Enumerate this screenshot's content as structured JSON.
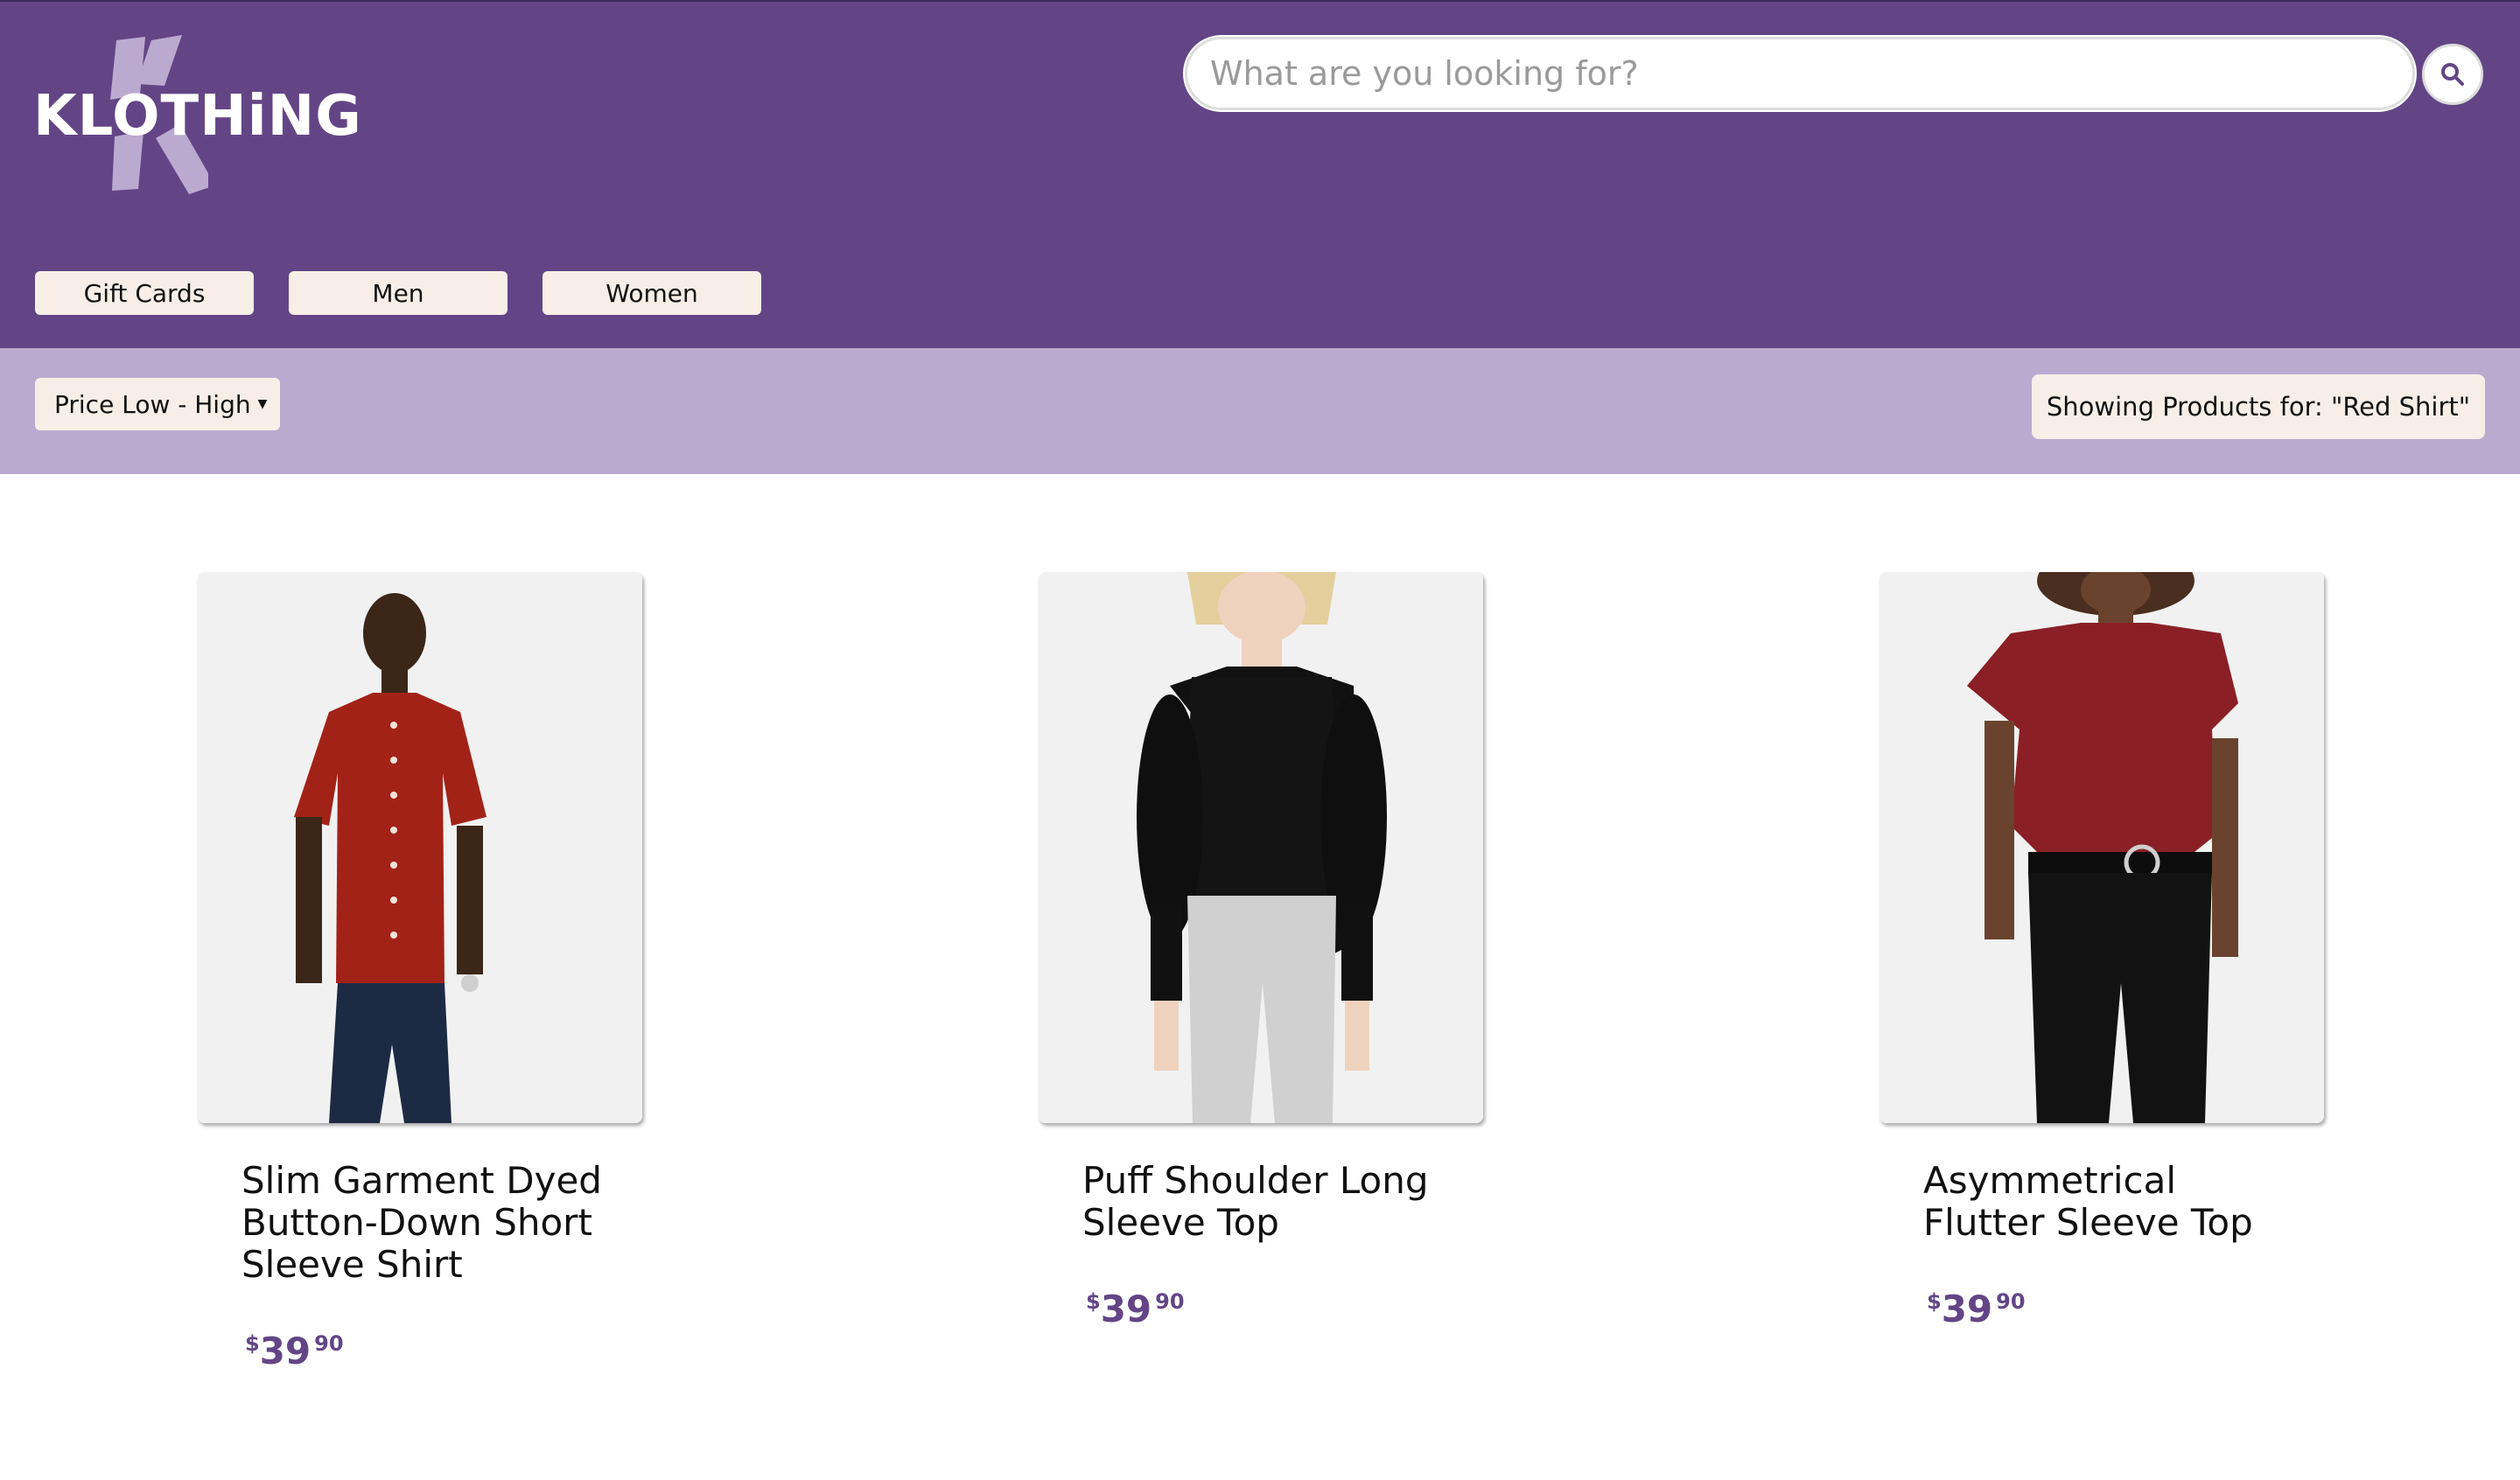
{
  "brand": {
    "name": "KLOTHiNG",
    "color": "#634586",
    "accent": "#bbaad0"
  },
  "search": {
    "placeholder": "What are you looking for?",
    "icon": "search-icon"
  },
  "nav": {
    "items": [
      "Gift Cards",
      "Men",
      "Women"
    ]
  },
  "filters": {
    "sort_label": "Price Low - High",
    "showing_text": "Showing Products for:  \"Red Shirt\""
  },
  "products": [
    {
      "title": "Slim Garment Dyed Button-Down Short Sleeve Shirt",
      "currency": "$",
      "dollars": "39",
      "cents": "90",
      "image": "red short sleeve button-down shirt photo"
    },
    {
      "title": "Puff Shoulder Long Sleeve Top",
      "currency": "$",
      "dollars": "39",
      "cents": "90",
      "image": "black puff shoulder long sleeve top photo"
    },
    {
      "title": "Asymmetrical Flutter Sleeve Top",
      "currency": "$",
      "dollars": "39",
      "cents": "90",
      "image": "red asymmetrical flutter sleeve top photo"
    }
  ]
}
